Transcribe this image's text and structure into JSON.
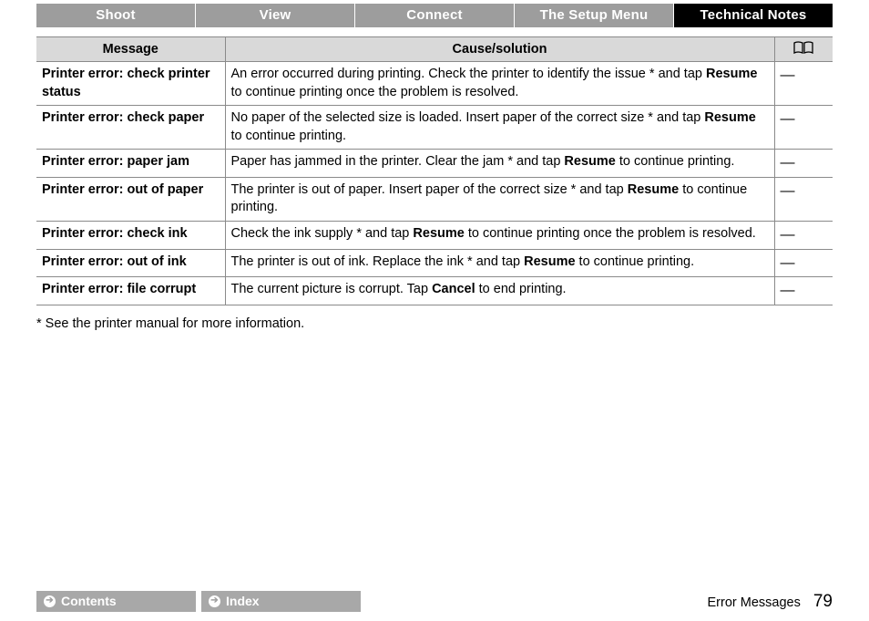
{
  "tabs": [
    {
      "label": "Shoot",
      "active": false
    },
    {
      "label": "View",
      "active": false
    },
    {
      "label": "Connect",
      "active": false
    },
    {
      "label": "The Setup Menu",
      "active": false
    },
    {
      "label": "Technical Notes",
      "active": true
    }
  ],
  "table": {
    "headers": {
      "message": "Message",
      "cause": "Cause/solution",
      "ref_icon": "book-icon"
    },
    "rows": [
      {
        "message": "Printer error: check printer status",
        "cause_pre": "An error occurred during printing. Check the printer to identify the issue * and tap ",
        "cause_bold": "Resume",
        "cause_post": " to continue printing once the problem is resolved.",
        "ref": "—"
      },
      {
        "message": "Printer error: check paper",
        "cause_pre": "No paper of the selected size is loaded. Insert paper of the correct size * and tap ",
        "cause_bold": "Resume",
        "cause_post": " to continue printing.",
        "ref": "—"
      },
      {
        "message": "Printer error: paper jam",
        "cause_pre": "Paper has jammed in the printer. Clear the jam * and tap ",
        "cause_bold": "Resume",
        "cause_post": " to continue printing.",
        "ref": "—"
      },
      {
        "message": "Printer error: out of paper",
        "cause_pre": "The printer is out of paper. Insert paper of the correct size * and tap ",
        "cause_bold": "Resume",
        "cause_post": " to continue printing.",
        "ref": "—"
      },
      {
        "message": "Printer error: check ink",
        "cause_pre": "Check the ink supply * and tap ",
        "cause_bold": "Resume",
        "cause_post": " to continue printing once the problem is resolved.",
        "ref": "—"
      },
      {
        "message": "Printer error: out of ink",
        "cause_pre": "The printer is out of ink. Replace the ink * and tap ",
        "cause_bold": "Resume",
        "cause_post": " to continue printing.",
        "ref": "—"
      },
      {
        "message": "Printer error: file corrupt",
        "cause_pre": "The current picture is corrupt. Tap ",
        "cause_bold": "Cancel",
        "cause_post": " to end printing.",
        "ref": "—"
      }
    ]
  },
  "footnote": "* See the printer manual for more information.",
  "footer": {
    "contents_label": "Contents",
    "index_label": "Index",
    "section": "Error Messages",
    "page": "79"
  }
}
